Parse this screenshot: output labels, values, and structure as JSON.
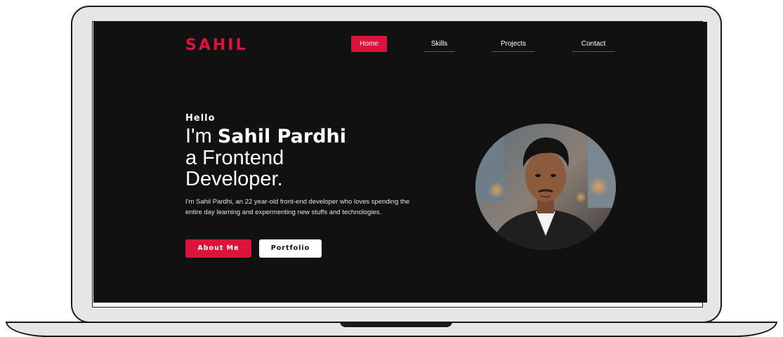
{
  "navbar": {
    "logo": "SAHIL",
    "items": [
      {
        "label": "Home",
        "active": true
      },
      {
        "label": "Skills",
        "active": false
      },
      {
        "label": "Projects",
        "active": false
      },
      {
        "label": "Contact",
        "active": false
      }
    ]
  },
  "hero": {
    "greeting": "Hello",
    "headline_prefix": "I'm ",
    "name": "Sahil Pardhi",
    "headline_line2": "a Frontend",
    "headline_line3": "Developer.",
    "bio": "I'm Sahil Pardhi, an 22 year-old front-end developer who loves spending the entire day learning and expermenting new stuffs and technologies.",
    "primary_button": "About Me",
    "secondary_button": "Portfolio"
  },
  "colors": {
    "accent": "#dc143c",
    "background": "#111111",
    "text": "#ffffff"
  }
}
